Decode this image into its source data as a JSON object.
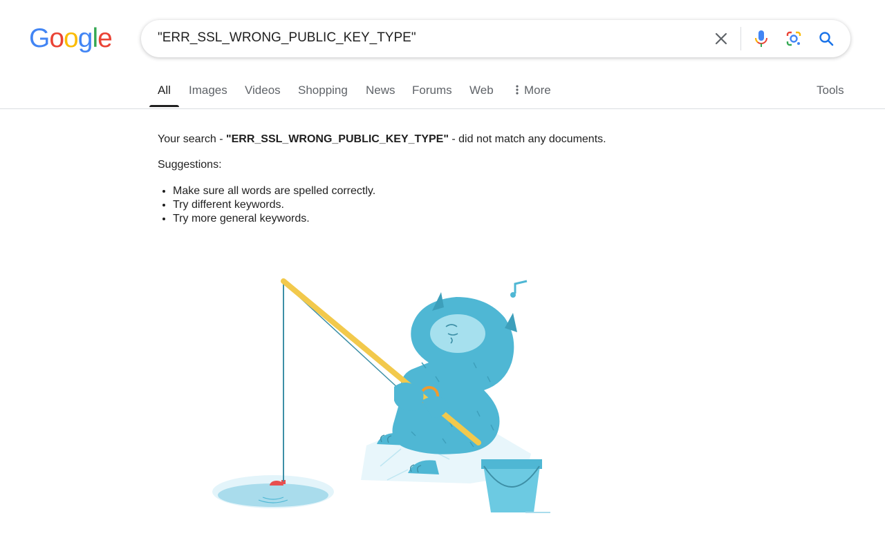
{
  "logo": {
    "letters": [
      "G",
      "o",
      "o",
      "g",
      "l",
      "e"
    ],
    "colors": [
      "#4285F4",
      "#EA4335",
      "#FBBC05",
      "#4285F4",
      "#34A853",
      "#EA4335"
    ]
  },
  "search": {
    "query": "\"ERR_SSL_WRONG_PUBLIC_KEY_TYPE\"",
    "icons": [
      "clear-icon",
      "microphone-icon",
      "lens-camera-icon",
      "search-icon"
    ]
  },
  "tabs": {
    "items": [
      {
        "label": "All",
        "active": true
      },
      {
        "label": "Images"
      },
      {
        "label": "Videos"
      },
      {
        "label": "Shopping"
      },
      {
        "label": "News"
      },
      {
        "label": "Forums"
      },
      {
        "label": "Web"
      },
      {
        "label": "More",
        "icon": "vertical-dots-icon"
      }
    ],
    "tools_label": "Tools"
  },
  "results": {
    "prefix": "Your search - ",
    "term": "\"ERR_SSL_WRONG_PUBLIC_KEY_TYPE\"",
    "suffix": " - did not match any documents.",
    "suggestions_label": "Suggestions:",
    "suggestions": [
      "Make sure all words are spelled correctly.",
      "Try different keywords.",
      "Try more general keywords."
    ]
  },
  "colors": {
    "accent": "#1a73e8",
    "text": "#1f1f1f",
    "muted": "#5f6368",
    "yeti": "#4fb7d4"
  }
}
